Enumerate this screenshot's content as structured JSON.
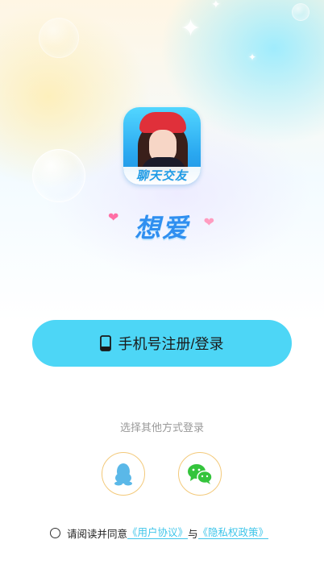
{
  "app": {
    "icon_caption": "聊天交友",
    "brand_name": "想爱"
  },
  "login": {
    "phone_button_label": "手机号注册/登录"
  },
  "other_login": {
    "title": "选择其他方式登录",
    "providers": [
      {
        "name": "QQ",
        "icon": "qq-penguin-icon"
      },
      {
        "name": "WeChat",
        "icon": "wechat-icon"
      }
    ]
  },
  "agreement": {
    "prefix": "请阅读并同意",
    "user_agreement": "《用户协议》",
    "conjunction": "与",
    "privacy_policy": "《隐私权政策》"
  },
  "colors": {
    "accent": "#4dd6f6",
    "link": "#3ec5ea",
    "brand": "#2f8ff0",
    "social_border": "#f3c97a",
    "wechat_green": "#34c43c",
    "qq_blue": "#5ab8e8"
  }
}
